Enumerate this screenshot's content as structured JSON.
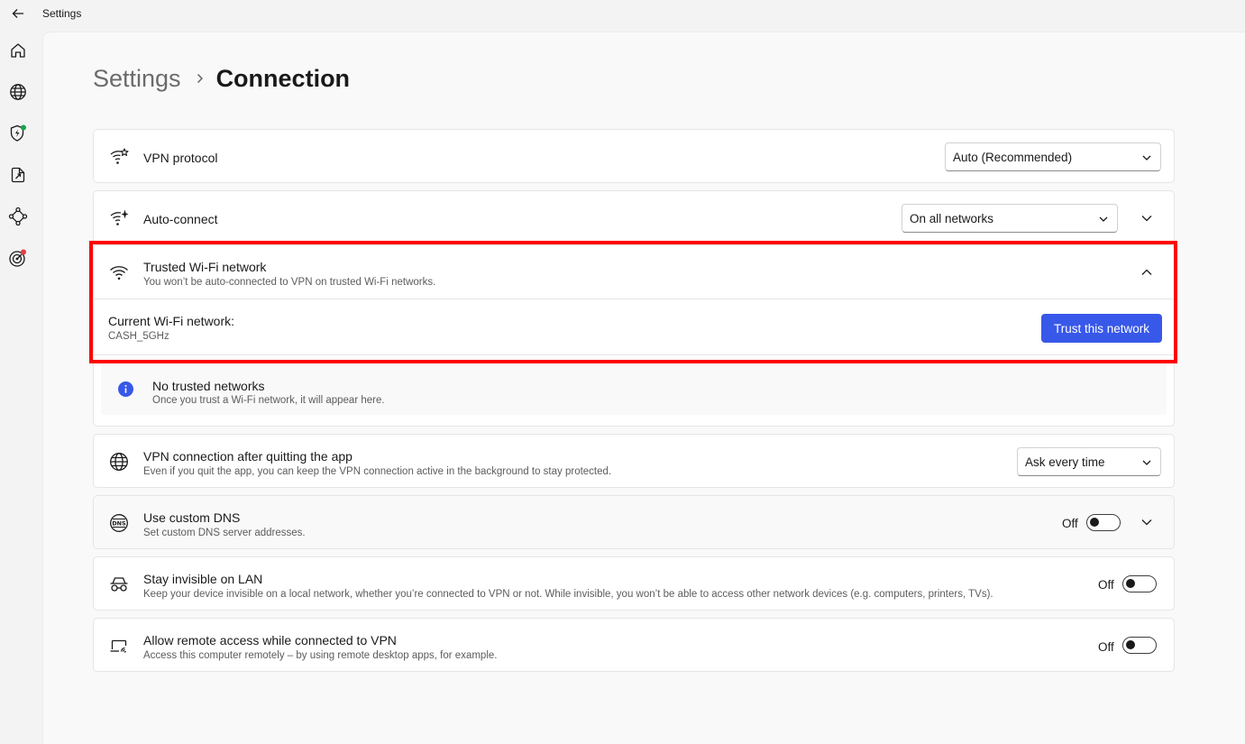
{
  "window": {
    "title": "Settings"
  },
  "breadcrumb": {
    "root": "Settings",
    "current": "Connection"
  },
  "rows": {
    "vpn_protocol": {
      "title": "VPN protocol",
      "select_value": "Auto (Recommended)"
    },
    "auto_connect": {
      "title": "Auto-connect",
      "select_value": "On all networks"
    },
    "trusted_wifi": {
      "title": "Trusted Wi-Fi network",
      "subtitle": "You won’t be auto-connected to VPN on trusted Wi-Fi networks.",
      "current_label": "Current Wi-Fi network:",
      "current_network": "CASH_5GHz",
      "trust_button": "Trust this network",
      "empty_title": "No trusted networks",
      "empty_subtitle": "Once you trust a Wi-Fi network, it will appear here."
    },
    "after_quit": {
      "title": "VPN connection after quitting the app",
      "subtitle": "Even if you quit the app, you can keep the VPN connection active in the background to stay protected.",
      "select_value": "Ask every time"
    },
    "custom_dns": {
      "title": "Use custom DNS",
      "subtitle": "Set custom DNS server addresses.",
      "toggle_label": "Off"
    },
    "invisible_lan": {
      "title": "Stay invisible on LAN",
      "subtitle": "Keep your device invisible on a local network, whether you’re connected to VPN or not. While invisible, you won’t be able to access other network devices (e.g. computers, printers, TVs).",
      "toggle_label": "Off"
    },
    "remote_access": {
      "title": "Allow remote access while connected to VPN",
      "subtitle": "Access this computer remotely – by using remote desktop apps, for example.",
      "toggle_label": "Off"
    }
  },
  "colors": {
    "accent": "#3858e9",
    "highlight": "#ff0000",
    "status_green": "#16a34a",
    "status_red": "#e53e3e"
  },
  "icons": {
    "sidebar": [
      "home-icon",
      "globe-icon",
      "shield-bolt-icon",
      "file-export-icon",
      "mesh-network-icon",
      "target-icon"
    ]
  }
}
